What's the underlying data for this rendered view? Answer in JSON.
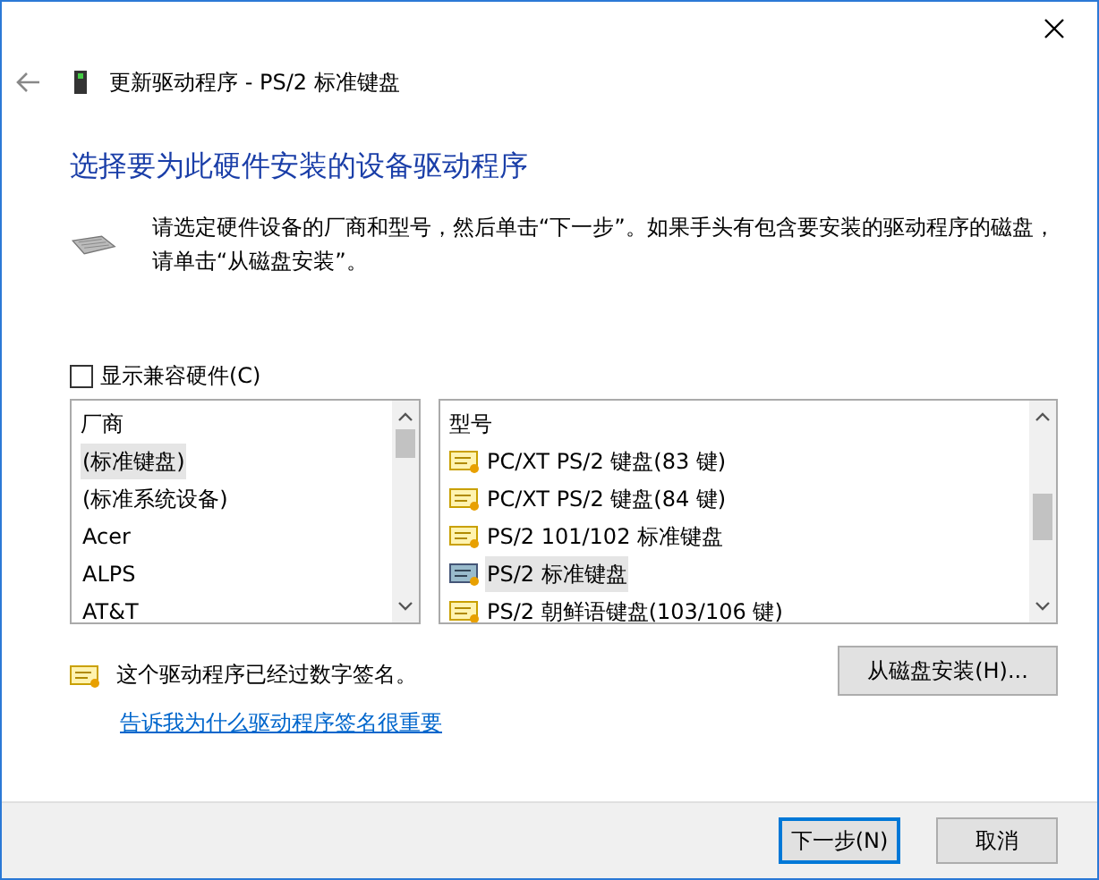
{
  "window": {
    "title": "更新驱动程序 - PS/2 标准键盘"
  },
  "heading": "选择要为此硬件安装的设备驱动程序",
  "description": "请选定硬件设备的厂商和型号，然后单击“下一步”。如果手头有包含要安装的驱动程序的磁盘，请单击“从磁盘安装”。",
  "show_compatible": {
    "label": "显示兼容硬件(C)",
    "checked": false
  },
  "manufacturers": {
    "header": "厂商",
    "items": [
      {
        "label": "(标准键盘)",
        "selected": true
      },
      {
        "label": "(标准系统设备)",
        "selected": false
      },
      {
        "label": "Acer",
        "selected": false
      },
      {
        "label": "ALPS",
        "selected": false
      },
      {
        "label": "AT&T",
        "selected": false
      }
    ]
  },
  "models": {
    "header": "型号",
    "items": [
      {
        "label": "PC/XT PS/2 键盘(83 键)",
        "selected": false
      },
      {
        "label": "PC/XT PS/2 键盘(84 键)",
        "selected": false
      },
      {
        "label": "PS/2 101/102 标准键盘",
        "selected": false
      },
      {
        "label": "PS/2 标准键盘",
        "selected": true
      },
      {
        "label": "PS/2 朝鲜语键盘(103/106 键)",
        "selected": false
      }
    ]
  },
  "signature": {
    "text": "这个驱动程序已经过数字签名。",
    "link": "告诉我为什么驱动程序签名很重要"
  },
  "have_disk_button": "从磁盘安装(H)...",
  "buttons": [
    "下一步(N)",
    "取消"
  ]
}
